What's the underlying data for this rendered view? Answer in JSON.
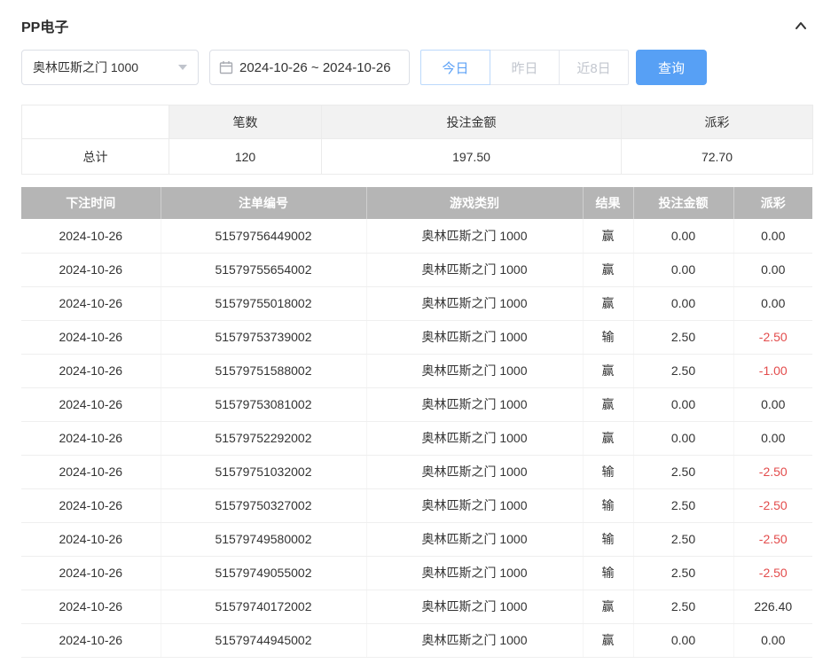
{
  "header": {
    "title": "PP电子"
  },
  "filters": {
    "game_select": {
      "value": "奥林匹斯之门 1000"
    },
    "date_range": {
      "value": "2024-10-26 ~ 2024-10-26"
    },
    "quick_buttons": [
      {
        "label": "今日",
        "active": true
      },
      {
        "label": "昨日",
        "active": false
      },
      {
        "label": "近8日",
        "active": false
      }
    ],
    "search_button": "查询"
  },
  "summary": {
    "columns": [
      "",
      "笔数",
      "投注金额",
      "派彩"
    ],
    "row": {
      "label": "总计",
      "count": "120",
      "bet_amount": "197.50",
      "payout": "72.70"
    }
  },
  "records": {
    "columns": [
      "下注时间",
      "注单编号",
      "游戏类别",
      "结果",
      "投注金额",
      "派彩"
    ],
    "rows": [
      [
        "2024-10-26",
        "51579756449002",
        "奥林匹斯之门 1000",
        "赢",
        "0.00",
        "0.00"
      ],
      [
        "2024-10-26",
        "51579755654002",
        "奥林匹斯之门 1000",
        "赢",
        "0.00",
        "0.00"
      ],
      [
        "2024-10-26",
        "51579755018002",
        "奥林匹斯之门 1000",
        "赢",
        "0.00",
        "0.00"
      ],
      [
        "2024-10-26",
        "51579753739002",
        "奥林匹斯之门 1000",
        "输",
        "2.50",
        "-2.50"
      ],
      [
        "2024-10-26",
        "51579751588002",
        "奥林匹斯之门 1000",
        "赢",
        "2.50",
        "-1.00"
      ],
      [
        "2024-10-26",
        "51579753081002",
        "奥林匹斯之门 1000",
        "赢",
        "0.00",
        "0.00"
      ],
      [
        "2024-10-26",
        "51579752292002",
        "奥林匹斯之门 1000",
        "赢",
        "0.00",
        "0.00"
      ],
      [
        "2024-10-26",
        "51579751032002",
        "奥林匹斯之门 1000",
        "输",
        "2.50",
        "-2.50"
      ],
      [
        "2024-10-26",
        "51579750327002",
        "奥林匹斯之门 1000",
        "输",
        "2.50",
        "-2.50"
      ],
      [
        "2024-10-26",
        "51579749580002",
        "奥林匹斯之门 1000",
        "输",
        "2.50",
        "-2.50"
      ],
      [
        "2024-10-26",
        "51579749055002",
        "奥林匹斯之门 1000",
        "输",
        "2.50",
        "-2.50"
      ],
      [
        "2024-10-26",
        "51579740172002",
        "奥林匹斯之门 1000",
        "赢",
        "2.50",
        "226.40"
      ],
      [
        "2024-10-26",
        "51579744945002",
        "奥林匹斯之门 1000",
        "赢",
        "0.00",
        "0.00"
      ]
    ]
  },
  "colors": {
    "accent_blue": "#57a0f5",
    "table_header_gray": "#b5b5b5",
    "negative_red": "#e34c4c"
  }
}
